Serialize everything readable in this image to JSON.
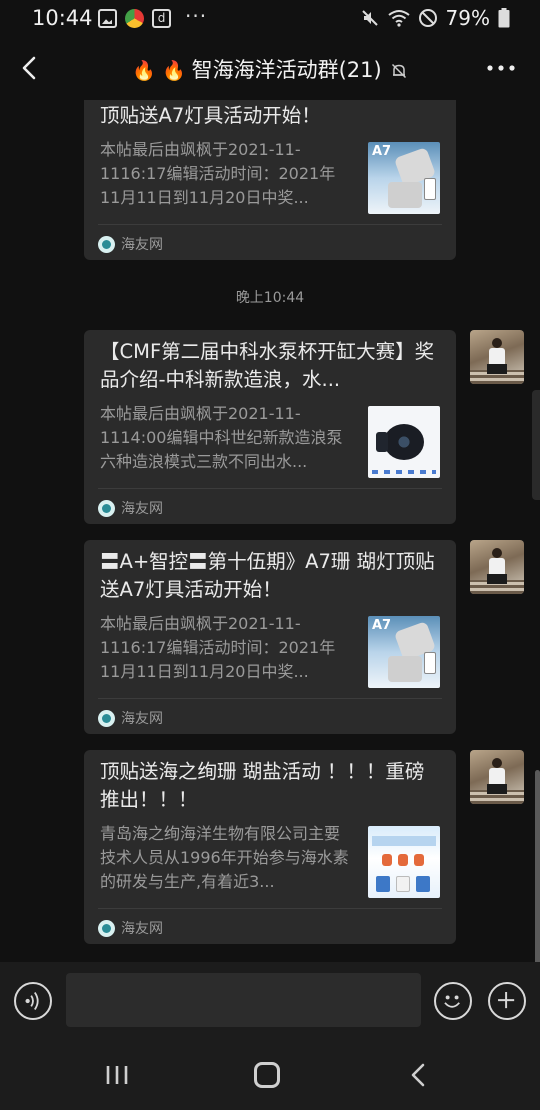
{
  "status_bar": {
    "time": "10:44",
    "battery": "79%",
    "more_dots": "···"
  },
  "header": {
    "title": "智海海洋活动群(21)",
    "fire_emoji": "🔥"
  },
  "chat": {
    "timestamp": "晚上10:44",
    "cards": [
      {
        "title": "顶贴送A7灯具活动开始！",
        "desc": "本帖最后由飒枫于2021-11-1116:17编辑活动时间：2021年11月11日到11月20日中奖...",
        "source": "海友网",
        "thumb": "a7",
        "thumb_label": "A7"
      },
      {
        "title": "【CMF第二届中科水泵杯开缸大赛】奖品介绍-中科新款造浪，水...",
        "desc": "本帖最后由飒枫于2021-11-1114:00编辑中科世纪新款造浪泵六种造浪模式三款不同出水...",
        "source": "海友网",
        "thumb": "pump"
      },
      {
        "title": "〓A+智控〓第十伍期》A7珊 瑚灯顶贴送A7灯具活动开始！",
        "desc": "本帖最后由飒枫于2021-11-1116:17编辑活动时间：2021年11月11日到11月20日中奖...",
        "source": "海友网",
        "thumb": "a7",
        "thumb_label": "A7"
      },
      {
        "title": "顶贴送海之绚珊 瑚盐活动 ！！！重磅推出！！！",
        "desc": "青岛海之绚海洋生物有限公司主要技术人员从1996年开始参与海水素的研发与生产,有着近3...",
        "source": "海友网",
        "thumb": "salt"
      }
    ]
  },
  "input": {
    "placeholder": ""
  }
}
